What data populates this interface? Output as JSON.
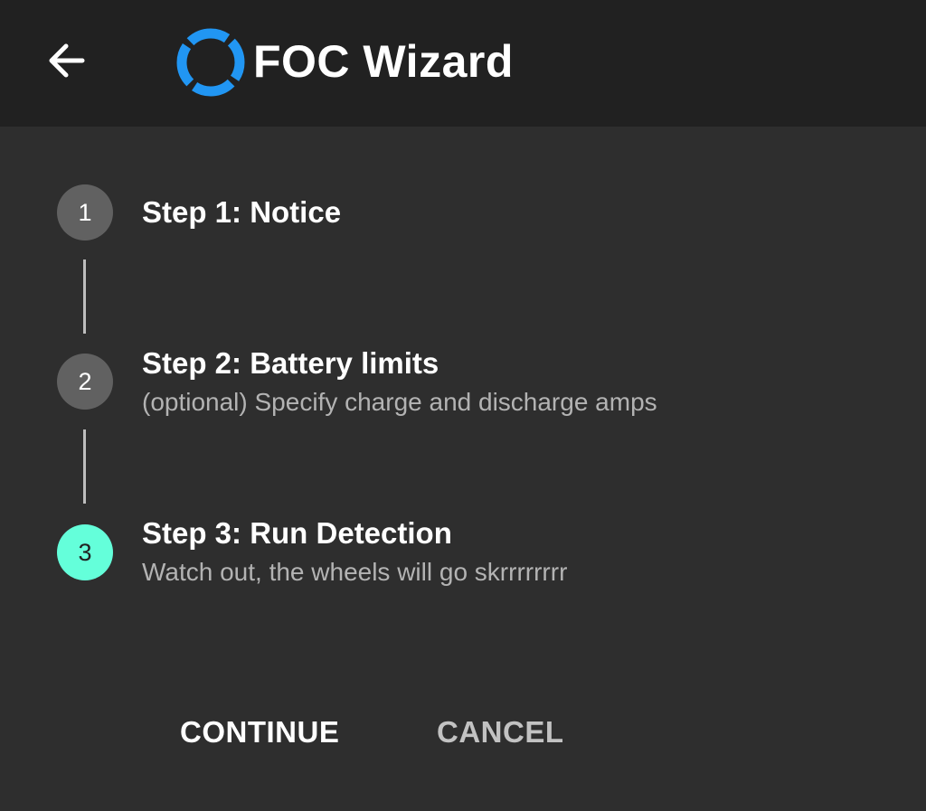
{
  "app_bar": {
    "back_icon": "arrow-left-icon",
    "logo_icon": "circle-logo-icon",
    "title": "FOC Wizard",
    "logo_color": "#2196f3"
  },
  "stepper": {
    "steps": [
      {
        "number": "1",
        "title": "Step 1: Notice",
        "subtitle": "",
        "state": "inactive"
      },
      {
        "number": "2",
        "title": "Step 2: Battery limits",
        "subtitle": "(optional) Specify charge and discharge amps",
        "state": "inactive"
      },
      {
        "number": "3",
        "title": "Step 3: Run Detection",
        "subtitle": "Watch out, the wheels will go skrrrrrrrr",
        "state": "active"
      }
    ],
    "active_color": "#64ffda",
    "inactive_color": "#616161"
  },
  "actions": {
    "continue_label": "CONTINUE",
    "cancel_label": "CANCEL"
  }
}
